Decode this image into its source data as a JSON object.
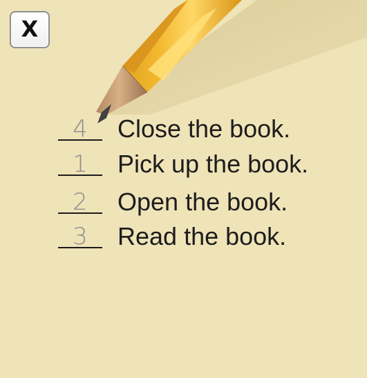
{
  "close_button": {
    "label": "X"
  },
  "steps": [
    {
      "number": "4",
      "text": "Close the book."
    },
    {
      "number": "1",
      "text": "Pick up the book."
    },
    {
      "number": "2",
      "text": "Open the book."
    },
    {
      "number": "3",
      "text": "Read the book."
    }
  ],
  "colors": {
    "background": "#efe3b8",
    "pencil": "#f3be2e",
    "text": "#1d1d1d",
    "handwriting": "#8c8c8c"
  }
}
